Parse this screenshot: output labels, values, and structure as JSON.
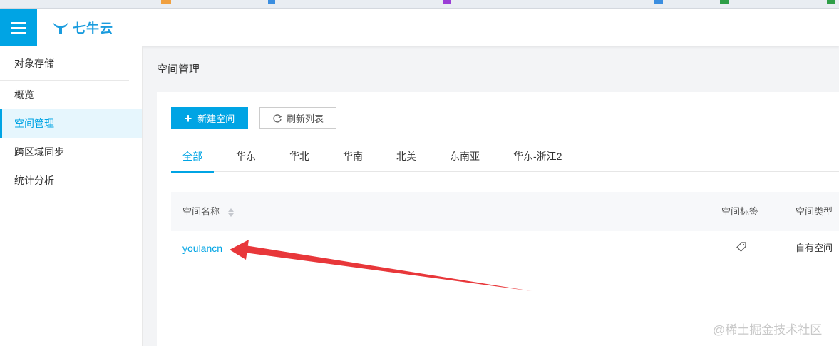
{
  "brand": {
    "name": "七牛云"
  },
  "sidebar": {
    "header": "对象存储",
    "items": [
      {
        "label": "概览"
      },
      {
        "label": "空间管理"
      },
      {
        "label": "跨区域同步"
      },
      {
        "label": "统计分析"
      }
    ],
    "active_index": 1
  },
  "page": {
    "title": "空间管理"
  },
  "toolbar": {
    "new_bucket_label": "新建空间",
    "refresh_label": "刷新列表"
  },
  "tabs": [
    {
      "label": "全部"
    },
    {
      "label": "华东"
    },
    {
      "label": "华北"
    },
    {
      "label": "华南"
    },
    {
      "label": "北美"
    },
    {
      "label": "东南亚"
    },
    {
      "label": "华东-浙江2"
    }
  ],
  "table": {
    "columns": [
      "空间名称",
      "空间标签",
      "空间类型"
    ],
    "rows": [
      {
        "name": "youlancn",
        "tag_icon": "tag-icon",
        "type": "自有空间"
      }
    ]
  },
  "annotation": {
    "arrow_color": "#e8373a"
  },
  "watermark": "@稀土掘金技术社区",
  "colors": {
    "accent": "#00a4e4",
    "annotation_arrow": "#e8373a"
  }
}
